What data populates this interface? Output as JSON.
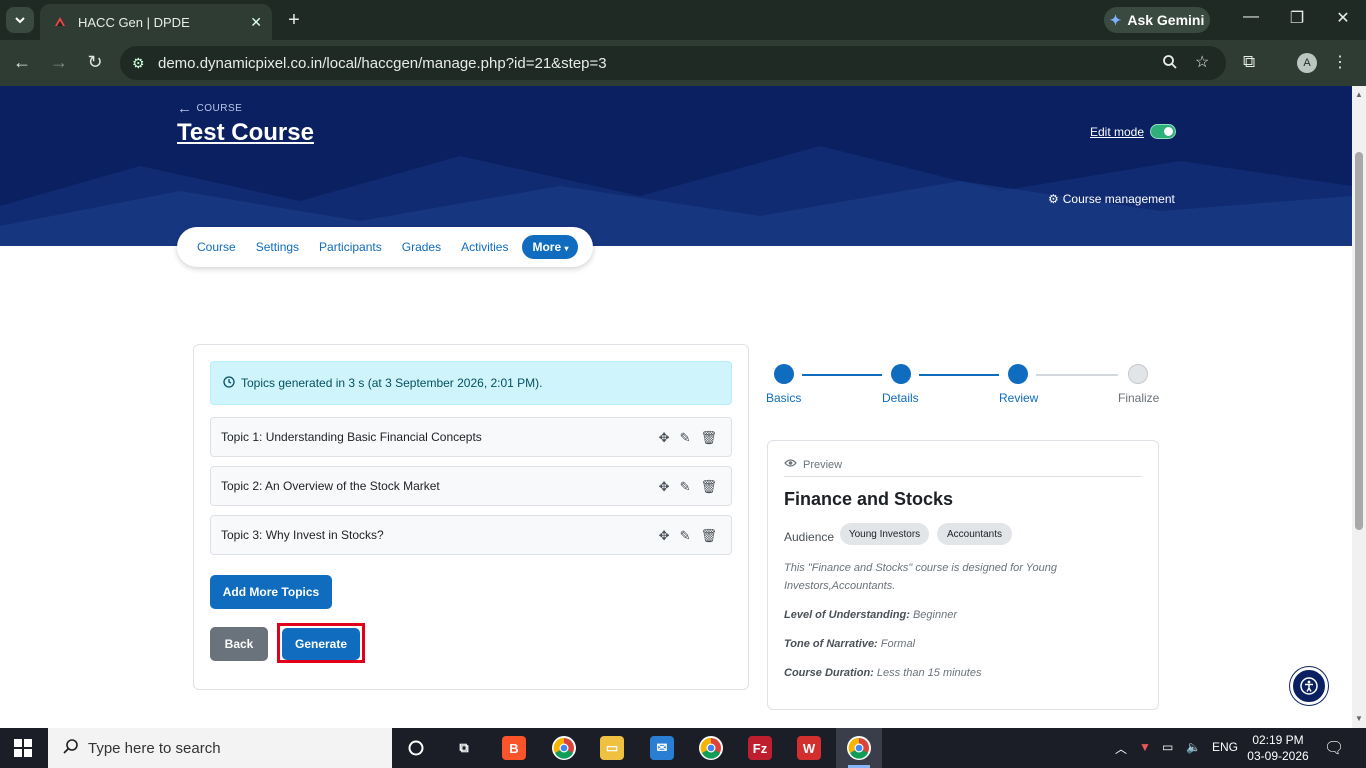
{
  "browser": {
    "tab_title": "HACC Gen | DPDE",
    "url": "demo.dynamicpixel.co.in/local/haccgen/manage.php?id=21&step=3",
    "gemini_label": "Ask Gemini",
    "profile_initial": "A"
  },
  "hero": {
    "back_label": "COURSE",
    "course_title": "Test Course",
    "edit_mode_label": "Edit mode",
    "edit_mode_on": true,
    "course_management_label": "Course management"
  },
  "secondary_nav": {
    "items": [
      "Course",
      "Settings",
      "Participants",
      "Grades",
      "Activities"
    ],
    "more_label": "More"
  },
  "main": {
    "alert_text": "Topics generated in 3 s (at 3 September 2026, 2:01 PM).",
    "topics": [
      "Topic 1: Understanding Basic Financial Concepts",
      "Topic 2: An Overview of the Stock Market",
      "Topic 3: Why Invest in Stocks?"
    ],
    "add_topics_label": "Add More Topics",
    "back_label": "Back",
    "generate_label": "Generate"
  },
  "stepper": {
    "steps": [
      {
        "label": "Basics",
        "state": "done"
      },
      {
        "label": "Details",
        "state": "done"
      },
      {
        "label": "Review",
        "state": "current"
      },
      {
        "label": "Finalize",
        "state": "todo"
      }
    ]
  },
  "preview": {
    "header": "Preview",
    "title": "Finance and Stocks",
    "audience_label": "Audience",
    "audience_chips": [
      "Young Investors",
      "Accountants"
    ],
    "description": "This \"Finance and Stocks\" course is designed for Young Investors,Accountants.",
    "level_label": "Level of Understanding:",
    "level_value": "Beginner",
    "tone_label": "Tone of Narrative:",
    "tone_value": "Formal",
    "duration_label": "Course Duration:",
    "duration_value": "Less than 15 minutes"
  },
  "taskbar": {
    "search_placeholder": "Type here to search",
    "language": "ENG",
    "time": "02:19 PM",
    "date": "03-09-2026"
  },
  "colors": {
    "brand_primary": "#0f6cbf",
    "hero_bg": "#0a2060",
    "highlight": "#e0001a",
    "alert_bg": "#cff4fc"
  }
}
